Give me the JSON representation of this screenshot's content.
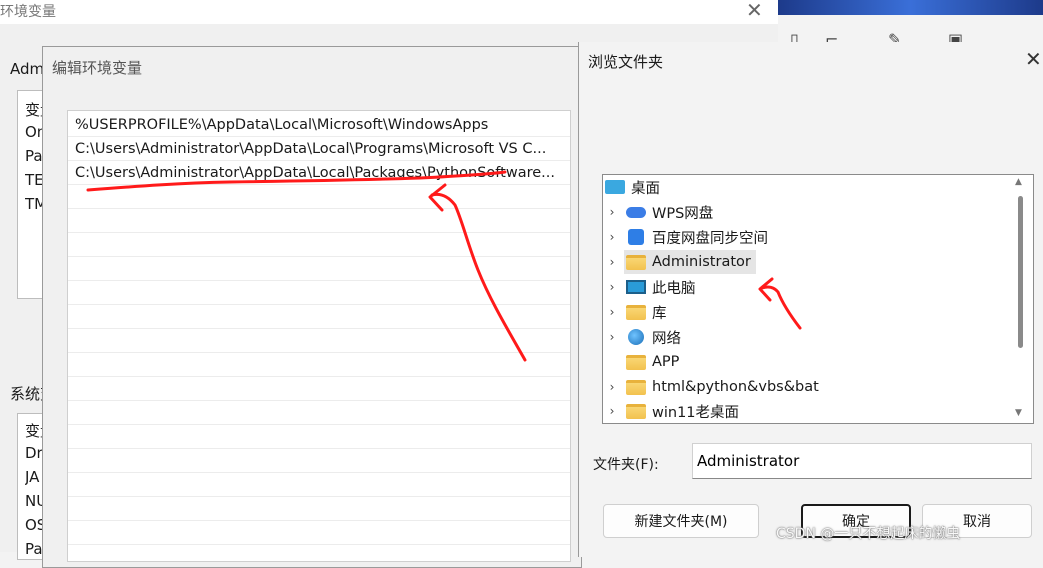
{
  "background_dialog": {
    "title": "环境变量",
    "user_section_label": "Admi",
    "user_rows": [
      "变量",
      "On",
      "Pa",
      "TE",
      "TM"
    ],
    "system_section_label": "系统变",
    "system_rows": [
      "变量",
      "Dr",
      "JA",
      "NU",
      "OS",
      "Pa"
    ]
  },
  "edit_dialog": {
    "title": "编辑环境变量",
    "paths": [
      "%USERPROFILE%\\AppData\\Local\\Microsoft\\WindowsApps",
      "C:\\Users\\Administrator\\AppData\\Local\\Programs\\Microsoft VS C...",
      "C:\\Users\\Administrator\\AppData\\Local\\Packages\\PythonSoftware..."
    ]
  },
  "browse_dialog": {
    "title": "浏览文件夹",
    "tree": [
      {
        "label": "桌面",
        "icon": "desktop-icon",
        "expandable": false
      },
      {
        "label": "WPS网盘",
        "icon": "cloud-icon",
        "expandable": true
      },
      {
        "label": "百度网盘同步空间",
        "icon": "baidu-icon",
        "expandable": true
      },
      {
        "label": "Administrator",
        "icon": "folder-icon",
        "expandable": true,
        "selected": true
      },
      {
        "label": "此电脑",
        "icon": "computer-icon",
        "expandable": true
      },
      {
        "label": "库",
        "icon": "folder-icon",
        "expandable": true
      },
      {
        "label": "网络",
        "icon": "network-icon",
        "expandable": true
      },
      {
        "label": "APP",
        "icon": "folder-icon",
        "expandable": false
      },
      {
        "label": "html&python&vbs&bat",
        "icon": "folder-icon",
        "expandable": true
      },
      {
        "label": "win11老桌面",
        "icon": "folder-icon",
        "expandable": true
      }
    ],
    "folder_label": "文件夹(F):",
    "folder_value": "Administrator",
    "new_folder_button": "新建文件夹(M)",
    "ok_button": "确定",
    "cancel_button": "取消"
  },
  "watermark": "CSDN @一只不想起床的懒虫",
  "colors": {
    "annotation": "#ff1a1a",
    "dialog_bg": "#f0f0f0",
    "selection": "#e5e5e5"
  }
}
